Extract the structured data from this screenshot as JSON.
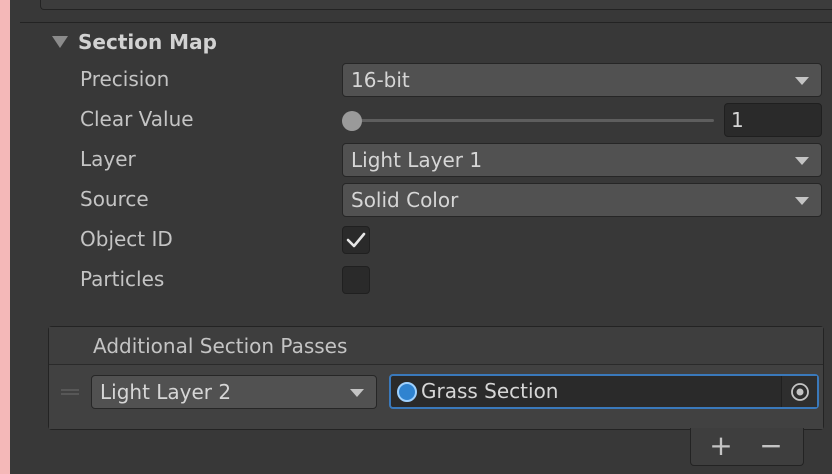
{
  "section": {
    "title": "Section Map"
  },
  "fields": {
    "precision": {
      "label": "Precision",
      "value": "16-bit"
    },
    "clear_value": {
      "label": "Clear Value",
      "value": "1",
      "slider_fraction": 0
    },
    "layer": {
      "label": "Layer",
      "value": "Light Layer 1"
    },
    "source": {
      "label": "Source",
      "value": "Solid Color"
    },
    "object_id": {
      "label": "Object ID",
      "checked": true
    },
    "particles": {
      "label": "Particles",
      "checked": false
    }
  },
  "passes": {
    "title": "Additional Section Passes",
    "items": [
      {
        "layer": "Light Layer 2",
        "object": "Grass Section"
      }
    ],
    "add_label": "+",
    "remove_label": "−"
  },
  "colors": {
    "panel_bg": "#383838",
    "accent_focus": "#3a79bb",
    "object_icon": "#2f83d0"
  },
  "icons": [
    "foldout-triangle-icon",
    "caret-down-icon",
    "checkmark-icon",
    "drag-handle-icon",
    "object-picker-icon",
    "asset-icon"
  ]
}
